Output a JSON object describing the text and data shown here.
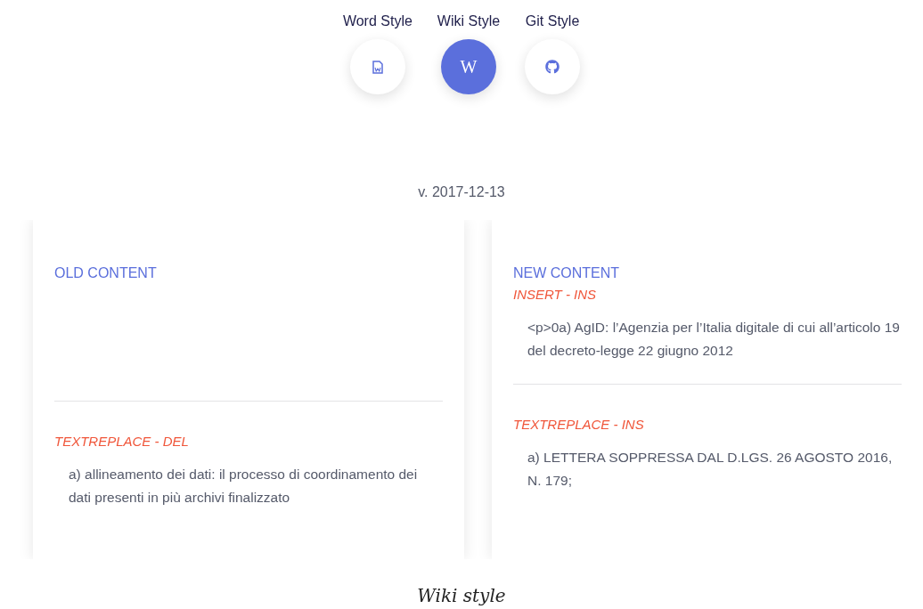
{
  "style_switcher": [
    {
      "label": "Word Style",
      "kind": "word",
      "selected": false
    },
    {
      "label": "Wiki Style",
      "kind": "wiki",
      "glyph": "W",
      "selected": true
    },
    {
      "label": "Git Style",
      "kind": "git",
      "selected": false
    }
  ],
  "version": "v. 2017-12-13",
  "panels": [
    {
      "title": "OLD CONTENT",
      "sections": [
        {
          "kind": "empty"
        },
        {
          "kind": "change",
          "label": "TEXTREPLACE - DEL",
          "text": "a) allineamento dei dati: il processo di coordinamento dei dati presenti in più archivi finalizzato"
        }
      ]
    },
    {
      "title": "NEW CONTENT",
      "sections": [
        {
          "kind": "change",
          "label": "INSERT - INS",
          "text": "<p>0a) AgID: l’Agenzia per l’Italia digitale di cui all’articolo 19 del decreto-legge 22 giugno 2012"
        },
        {
          "kind": "change",
          "label": "TEXTREPLACE - INS",
          "text": "a) LETTERA SOPPRESSA DAL D.LGS. 26 AGOSTO 2016, N. 179;"
        }
      ]
    }
  ],
  "caption": "Wiki style"
}
